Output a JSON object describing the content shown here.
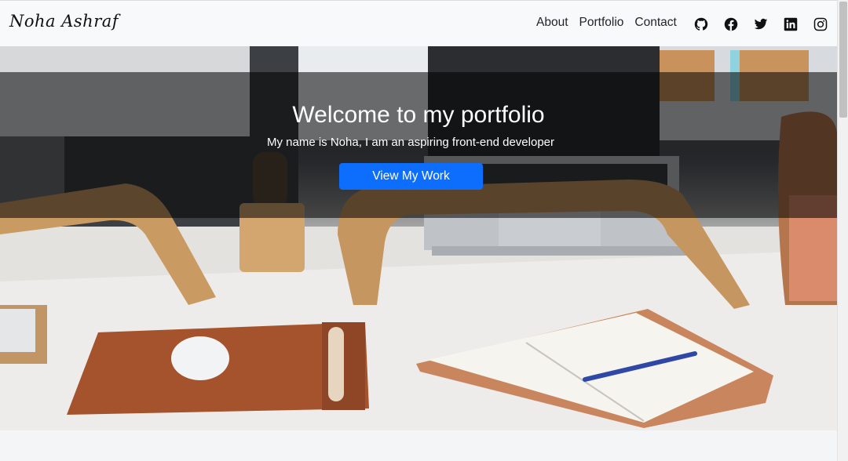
{
  "navbar": {
    "brand": "Noha Ashraf",
    "links": [
      {
        "label": "About"
      },
      {
        "label": "Portfolio"
      },
      {
        "label": "Contact"
      }
    ],
    "socials": [
      "github-icon",
      "facebook-icon",
      "twitter-icon",
      "linkedin-icon",
      "instagram-icon"
    ]
  },
  "hero": {
    "title": "Welcome to my portfolio",
    "subtitle": "My name is Noha, I am an aspiring front-end developer",
    "cta_label": "View My Work"
  },
  "colors": {
    "primary": "#0d6efd",
    "navbar_bg": "#f8f9fa"
  }
}
